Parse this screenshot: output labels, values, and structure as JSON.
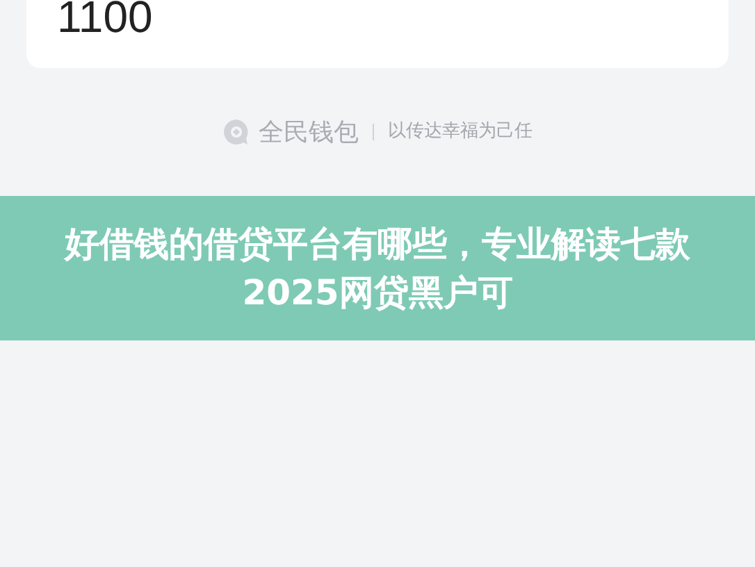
{
  "card": {
    "amount": "1100"
  },
  "brand": {
    "name": "全民钱包",
    "slogan": "以传达幸福为己任"
  },
  "banner": {
    "title": "好借钱的借贷平台有哪些，专业解读七款2025网贷黑户可"
  }
}
